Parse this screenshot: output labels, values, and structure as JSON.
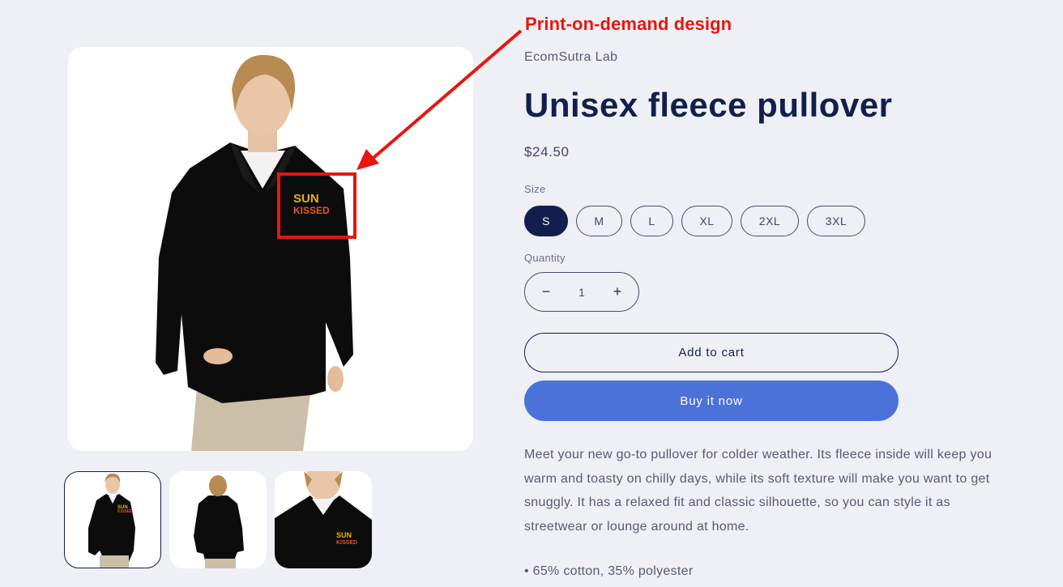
{
  "annotation": {
    "label": "Print-on-demand design",
    "color": "#e8160f"
  },
  "product": {
    "vendor": "EcomSutra Lab",
    "title": "Unisex fleece pullover",
    "price": "$24.50",
    "print_design_text": [
      "SUN",
      "KISSED"
    ],
    "size": {
      "label": "Size",
      "options": [
        "S",
        "M",
        "L",
        "XL",
        "2XL",
        "3XL"
      ],
      "selected": "S"
    },
    "quantity": {
      "label": "Quantity",
      "value": "1",
      "decrease_icon": "minus-icon",
      "increase_icon": "plus-icon"
    },
    "add_to_cart_label": "Add to cart",
    "buy_now_label": "Buy it now",
    "description": "Meet your new go-to pullover for colder weather. Its fleece inside will keep you warm and toasty on chilly days, while its soft texture will make you want to get snuggly. It has a relaxed fit and classic silhouette, so you can style it as streetwear or lounge around at home.",
    "bullets": [
      "• 65% cotton, 35% polyester"
    ]
  },
  "gallery": {
    "thumbnails": [
      {
        "alt": "Front view",
        "active": true
      },
      {
        "alt": "Back view",
        "active": false
      },
      {
        "alt": "Close-up view",
        "active": false
      }
    ]
  },
  "colors": {
    "background": "#eef0f5",
    "primary": "#121f4e",
    "accent": "#4a72d9"
  }
}
